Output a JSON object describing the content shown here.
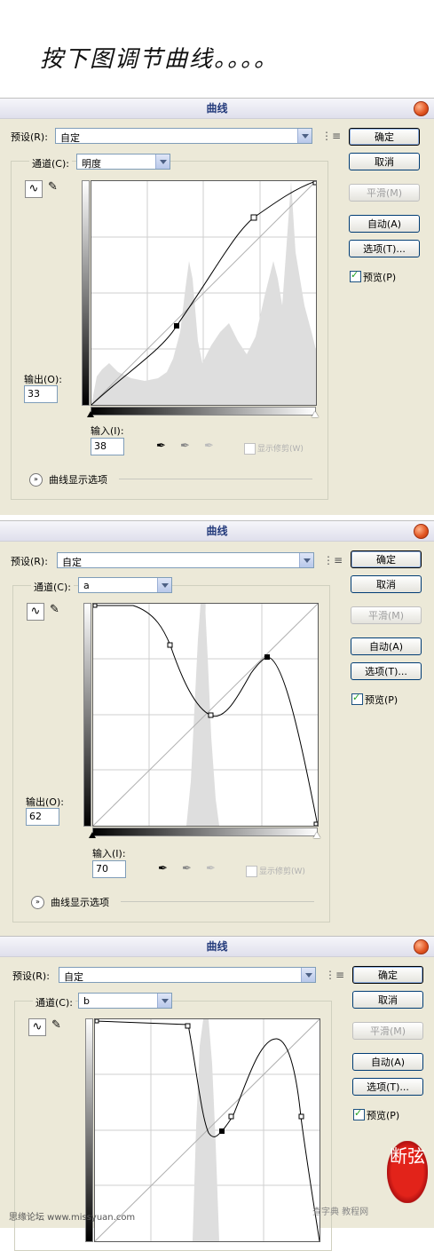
{
  "heading": "按下图调节曲线。。。。",
  "dialogs": [
    {
      "title": "曲线",
      "preset_label": "预设(R):",
      "preset_value": "自定",
      "channel_label": "通道(C):",
      "channel_value": "明度",
      "buttons": {
        "ok": "确定",
        "cancel": "取消",
        "smooth": "平滑(M)",
        "auto": "自动(A)",
        "options": "选项(T)..."
      },
      "preview_label": "预览(P)",
      "preview_checked": true,
      "output_label": "输出(O):",
      "output_value": "33",
      "input_label": "输入(I):",
      "input_value": "38",
      "clipping_label": "显示修剪(W)",
      "display_options_label": "曲线显示选项"
    },
    {
      "title": "曲线",
      "preset_label": "预设(R):",
      "preset_value": "自定",
      "channel_label": "通道(C):",
      "channel_value": "a",
      "buttons": {
        "ok": "确定",
        "cancel": "取消",
        "smooth": "平滑(M)",
        "auto": "自动(A)",
        "options": "选项(T)..."
      },
      "preview_label": "预览(P)",
      "preview_checked": true,
      "output_label": "输出(O):",
      "output_value": "62",
      "input_label": "输入(I):",
      "input_value": "70",
      "clipping_label": "显示修剪(W)",
      "display_options_label": "曲线显示选项"
    },
    {
      "title": "曲线",
      "preset_label": "预设(R):",
      "preset_value": "自定",
      "channel_label": "通道(C):",
      "channel_value": "b",
      "buttons": {
        "ok": "确定",
        "cancel": "取消",
        "smooth": "平滑(M)",
        "auto": "自动(A)",
        "options": "选项(T)..."
      },
      "preview_label": "预览(P)",
      "preview_checked": true
    }
  ],
  "watermark_left": "思缘论坛 www.missyuan.com",
  "watermark_right": "查字典 教程网",
  "seal_text": "断弦",
  "icons": {
    "close": "close-icon",
    "menu": "panel-menu-icon",
    "curve_tool": "curve-tool-icon",
    "pencil_tool": "pencil-icon",
    "eyedropper": "eyedropper-icon",
    "expand": "chevron-expand-icon"
  },
  "colors": {
    "title_text": "#233a7b",
    "close_button": "#e0521f",
    "histogram": "#dedede",
    "dialog_bg": "#ece9d8"
  }
}
